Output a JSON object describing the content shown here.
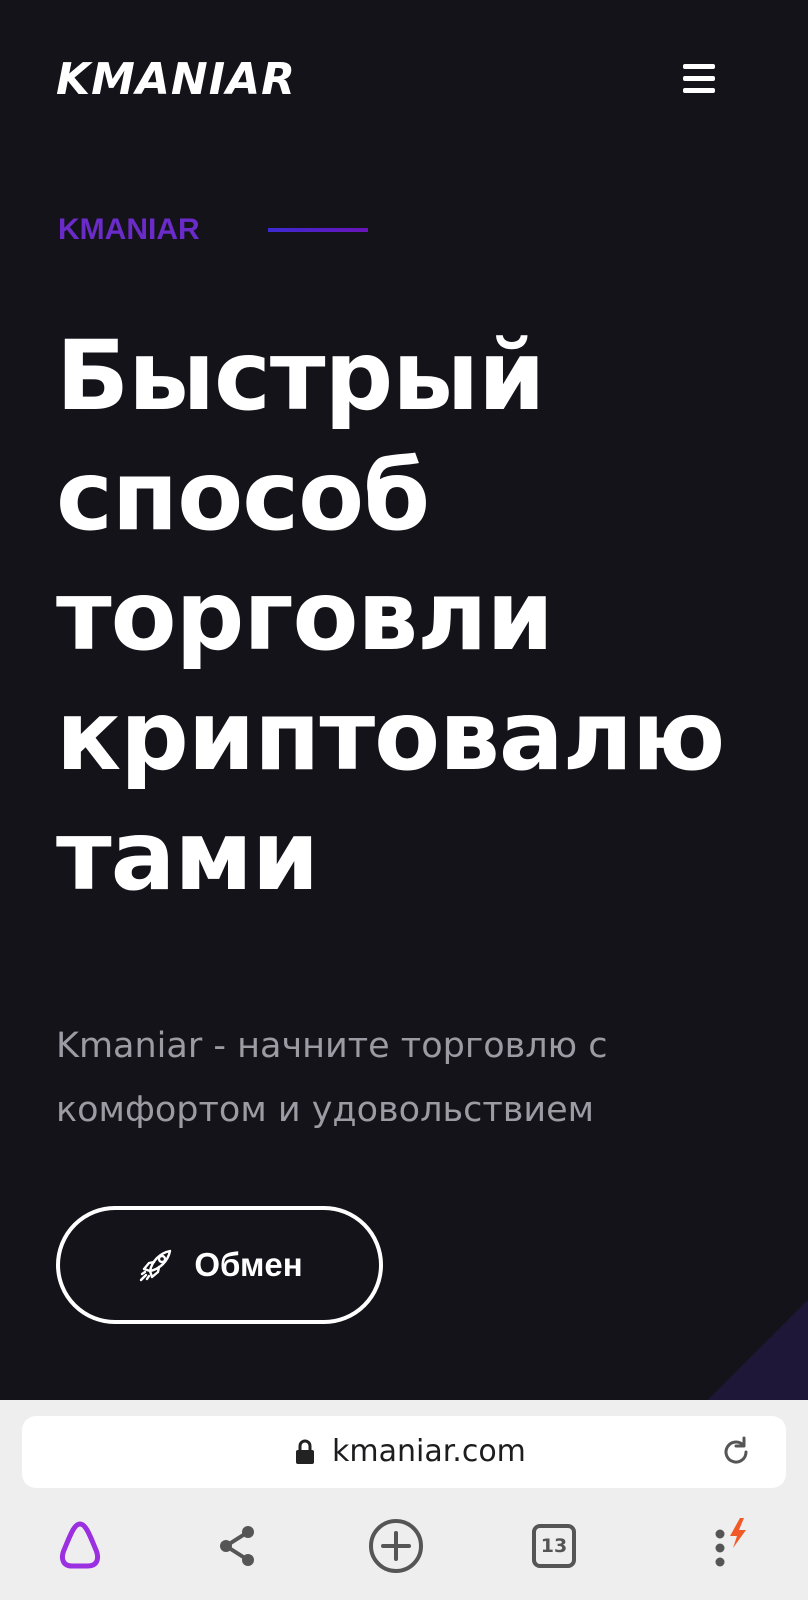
{
  "header": {
    "logo": "KMANIAR",
    "menu_icon": "hamburger-menu-icon"
  },
  "hero": {
    "eyebrow": "KMANIAR",
    "title_lines": [
      "Быстрый",
      "способ",
      "торговли",
      "криптовалю",
      "тами"
    ],
    "subtitle_lines": [
      "Kmaniar - начните торговлю с",
      "комфортом и удовольствием"
    ],
    "cta_label": "Обмен",
    "cta_icon": "rocket-icon"
  },
  "browser": {
    "url": "kmaniar.com",
    "lock_icon": "lock-icon",
    "reload_icon": "reload-icon",
    "tabs_count": "13",
    "nav_icons": [
      "alice-assistant-icon",
      "share-icon",
      "new-tab-icon",
      "tabs-icon",
      "more-menu-icon"
    ]
  },
  "colors": {
    "background": "#141319",
    "accent_purple": "#6a2bc9",
    "text_white": "#ffffff",
    "subtitle_gray": "#9c9aa3",
    "browser_bar": "#eeeeef",
    "alice_purple": "#9b30e0",
    "bolt_orange": "#f05a28"
  }
}
